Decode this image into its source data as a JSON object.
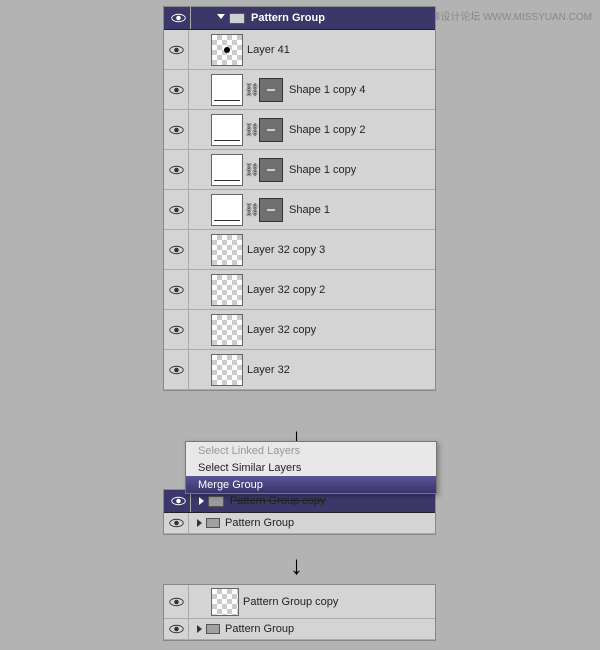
{
  "watermark_cn": "思缘设计论坛",
  "watermark_url": "WWW.MISSYUAN.COM",
  "panel1": {
    "group_label": "Pattern Group",
    "layers": [
      {
        "label": "Layer 41",
        "thumb": "dot",
        "mask": false
      },
      {
        "label": "Shape 1 copy 4",
        "thumb": "wline",
        "mask": true
      },
      {
        "label": "Shape 1 copy 2",
        "thumb": "wline",
        "mask": true
      },
      {
        "label": "Shape 1 copy",
        "thumb": "wline",
        "mask": true
      },
      {
        "label": "Shape 1",
        "thumb": "wline",
        "mask": true
      },
      {
        "label": "Layer 32 copy 3",
        "thumb": "chk",
        "mask": false
      },
      {
        "label": "Layer 32 copy 2",
        "thumb": "chk",
        "mask": false
      },
      {
        "label": "Layer 32 copy",
        "thumb": "chk",
        "mask": false
      },
      {
        "label": "Layer 32",
        "thumb": "chk",
        "mask": false
      }
    ]
  },
  "menu": {
    "item1": "Select Linked Layers",
    "item2": "Select Similar Layers",
    "item3": "Merge Group"
  },
  "panel2": {
    "group1": "Pattern Group copy",
    "group2": "Pattern Group"
  },
  "panel3": {
    "layer": "Pattern Group copy",
    "group": "Pattern Group"
  }
}
